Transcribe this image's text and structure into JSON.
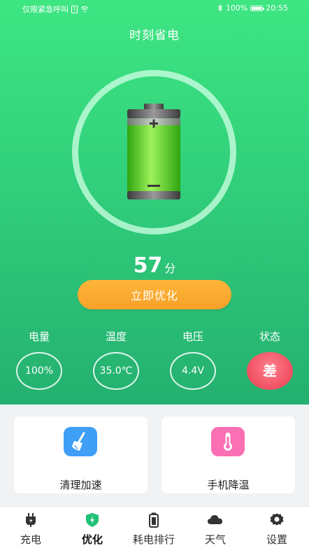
{
  "status_bar": {
    "left_text": "仅限紧急呼叫",
    "battery": "100%",
    "time": "20:55"
  },
  "header": {
    "title": "时刻省电"
  },
  "score": {
    "value": "57",
    "unit": "分"
  },
  "optimize_label": "立即优化",
  "stats": [
    {
      "label": "电量",
      "value": "100%"
    },
    {
      "label": "温度",
      "value": "35.0℃"
    },
    {
      "label": "电压",
      "value": "4.4V"
    },
    {
      "label": "状态",
      "value": "差"
    }
  ],
  "cards": [
    {
      "label": "清理加速",
      "icon": "broom-icon",
      "color": "#3f9ef6"
    },
    {
      "label": "手机降温",
      "icon": "thermometer-icon",
      "color": "#fb6fb4"
    }
  ],
  "tabs": [
    {
      "label": "充电",
      "icon": "charger-icon"
    },
    {
      "label": "优化",
      "icon": "shield-bolt-icon"
    },
    {
      "label": "耗电排行",
      "icon": "battery-icon"
    },
    {
      "label": "天气",
      "icon": "cloud-icon"
    },
    {
      "label": "设置",
      "icon": "gear-icon"
    }
  ],
  "active_tab": "优化",
  "colors": {
    "hero_top": "#3ee682",
    "hero_bottom": "#24b070",
    "button": "#f7a12a",
    "status_bad": "#f04f62"
  }
}
